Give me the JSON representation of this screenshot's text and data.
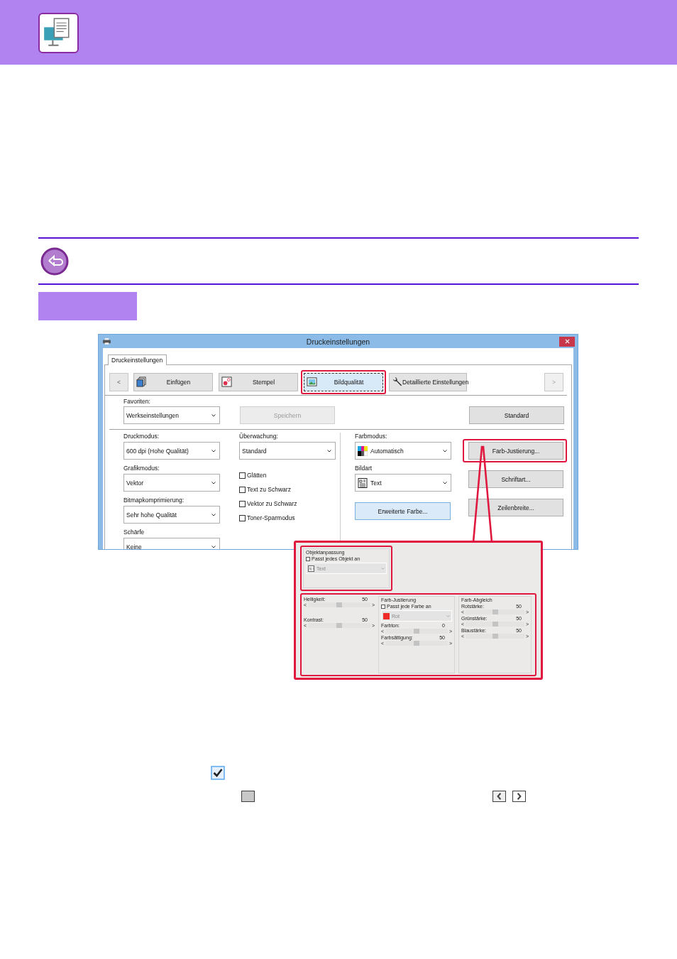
{
  "dialog": {
    "title": "Druckeinstellungen",
    "tab": "Druckeinstellungen",
    "nav_prev": "<",
    "nav_next": ">",
    "toolbar": [
      {
        "label": "Einfügen",
        "kind": "copies",
        "selected": false,
        "highlighted": false
      },
      {
        "label": "Stempel",
        "kind": "stamp",
        "selected": false,
        "highlighted": false
      },
      {
        "label": "Bildqualität",
        "kind": "image",
        "selected": true,
        "highlighted": true
      },
      {
        "label": "Detaillierte Einstellungen",
        "kind": "wrench",
        "selected": false,
        "highlighted": false
      }
    ],
    "favorites": {
      "label": "Favoriten:",
      "value": "Werkseinstellungen"
    },
    "save_button": {
      "label": "Speichern",
      "disabled": true
    },
    "standard_button": {
      "label": "Standard",
      "disabled": false
    },
    "column_1": [
      {
        "label": "Druckmodus:",
        "value": "600 dpi (Hohe Qualität)"
      },
      {
        "label": "Grafikmodus:",
        "value": "Vektor"
      },
      {
        "label": "Bitmapkomprimierung:",
        "value": "Sehr hohe Qualität"
      },
      {
        "label": "Schärfe",
        "value": "Keine"
      }
    ],
    "monitoring": {
      "label": "Überwachung:",
      "value": "Standard"
    },
    "checkboxes": [
      {
        "label": "Glätten",
        "checked": false
      },
      {
        "label": "Text zu Schwarz",
        "checked": false
      },
      {
        "label": "Vektor zu Schwarz",
        "checked": false
      },
      {
        "label": "Toner-Sparmodus",
        "checked": false
      }
    ],
    "color_mode": {
      "label": "Farbmodus:",
      "value": "Automatisch"
    },
    "image_type": {
      "label": "Bildart",
      "value": "Text"
    },
    "extended_color_button": {
      "label": "Erweiterte Farbe..."
    },
    "side_buttons": [
      {
        "label": "Farb-Justierung...",
        "highlighted": true
      },
      {
        "label": "Schriftart...",
        "highlighted": false
      },
      {
        "label": "Zeilenbreite...",
        "highlighted": false
      }
    ]
  },
  "callout": {
    "object_group": {
      "title": "Objektanpassung",
      "checkbox": {
        "label": "Passt jedes Objekt an",
        "checked": false
      },
      "value": "Text"
    },
    "brightness_sliders": [
      {
        "label": "Helligkeit:",
        "reading": "50",
        "level": 0.5,
        "left": "<",
        "right": ">"
      },
      {
        "label": "Kontrast:",
        "reading": "50",
        "level": 0.5,
        "left": "<",
        "right": ">"
      }
    ],
    "color_adjust_group": {
      "title": "Farb-Justierung",
      "checkbox": {
        "label": "Passt jede Farbe an",
        "checked": false
      },
      "value": "Rot",
      "sliders": [
        {
          "label": "Farbton:",
          "reading": "0",
          "level": 0.5,
          "left": "<",
          "right": ">"
        },
        {
          "label": "Farbsättigung:",
          "reading": "50",
          "level": 0.5,
          "left": "<",
          "right": ">"
        }
      ]
    },
    "color_balance_group": {
      "title": "Farb-Abgleich",
      "sliders": [
        {
          "label": "Rotstärke:",
          "reading": "50",
          "level": 0.5,
          "left": "<",
          "right": ">"
        },
        {
          "label": "Grünstärke:",
          "reading": "50",
          "level": 0.5,
          "left": "<",
          "right": ">"
        },
        {
          "label": "Blaustärke:",
          "reading": "50",
          "level": 0.5,
          "left": "<",
          "right": ">"
        }
      ]
    }
  },
  "legend": {
    "checkbox": {
      "checked": true
    }
  }
}
